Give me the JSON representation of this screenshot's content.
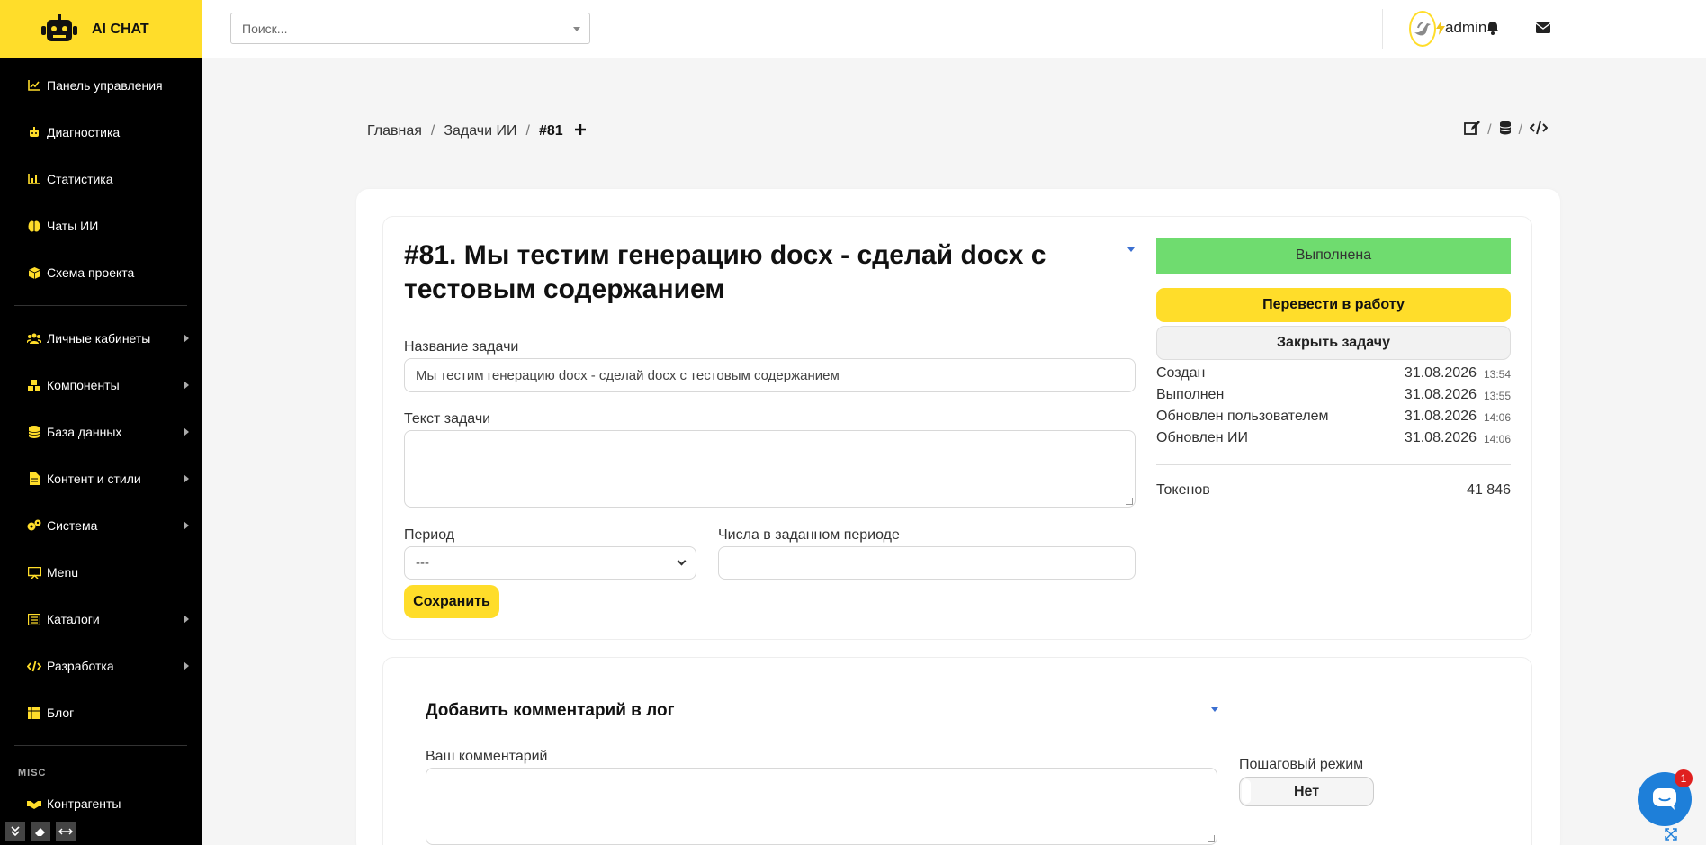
{
  "brand": {
    "name": "AI CHAT",
    "icon": "robot-icon"
  },
  "sidebar": {
    "items": [
      {
        "label": "Панель управления",
        "icon": "chart-line-icon",
        "arrow": false
      },
      {
        "label": "Диагностика",
        "icon": "robot-icon",
        "arrow": false
      },
      {
        "label": "Статистика",
        "icon": "bar-chart-icon",
        "arrow": false
      },
      {
        "label": "Чаты ИИ",
        "icon": "brain-icon",
        "arrow": false
      },
      {
        "label": "Схема проекта",
        "icon": "cube-icon",
        "arrow": false
      },
      {
        "label": "Личные кабинеты",
        "icon": "users-icon",
        "arrow": true
      },
      {
        "label": "Компоненты",
        "icon": "cubes-icon",
        "arrow": true
      },
      {
        "label": "База данных",
        "icon": "database-icon",
        "arrow": true
      },
      {
        "label": "Контент и стили",
        "icon": "file-icon",
        "arrow": true
      },
      {
        "label": "Система",
        "icon": "cogs-icon",
        "arrow": true
      },
      {
        "label": "Menu",
        "icon": "menu-board-icon",
        "arrow": false
      },
      {
        "label": "Каталоги",
        "icon": "list-icon",
        "arrow": true
      },
      {
        "label": "Разработка",
        "icon": "code-icon",
        "arrow": true
      },
      {
        "label": "Блог",
        "icon": "table-list-icon",
        "arrow": false
      }
    ],
    "misc_label": "MISC",
    "misc_items": [
      {
        "label": "Контрагенты",
        "icon": "handshake-icon"
      }
    ]
  },
  "header": {
    "search_placeholder": "Поиск...",
    "icons": [
      "bolt-icon",
      "bell-icon",
      "envelope-icon"
    ],
    "username": "admin"
  },
  "breadcrumb": {
    "home": "Главная",
    "section": "Задачи ИИ",
    "current": "#81",
    "separator": "/"
  },
  "task": {
    "title": "#81. Мы тестим генерацию docx - сделай docx с тестовым содержанием",
    "name_label": "Название задачи",
    "name_value": "Мы тестим генерацию docx - сделай docx с тестовым содержанием",
    "text_label": "Текст задачи",
    "text_value": "",
    "period_label": "Период",
    "period_value": "---",
    "numbers_label": "Числа в заданном периоде",
    "numbers_value": "",
    "save_label": "Сохранить"
  },
  "status": {
    "label": "Выполнена",
    "color": "#6fdc6f",
    "to_work_label": "Перевести в работу",
    "close_label": "Закрыть задачу"
  },
  "meta": [
    {
      "key": "Создан",
      "date": "31.08.2026",
      "time": "13:54"
    },
    {
      "key": "Выполнен",
      "date": "31.08.2026",
      "time": "13:55"
    },
    {
      "key": "Обновлен пользователем",
      "date": "31.08.2026",
      "time": "14:06"
    },
    {
      "key": "Обновлен ИИ",
      "date": "31.08.2026",
      "time": "14:06"
    }
  ],
  "tokens": {
    "label": "Токенов",
    "value": "41 846"
  },
  "comment": {
    "title": "Добавить комментарий в лог",
    "label": "Ваш комментарий",
    "value": "",
    "step_label": "Пошаговый режим",
    "step_value": "Нет"
  },
  "chat_widget": {
    "badge": "1"
  },
  "colors": {
    "accent": "#ffdd2a",
    "sidebar": "#000000",
    "success": "#6fdc6f",
    "link": "#3b6fd1"
  }
}
